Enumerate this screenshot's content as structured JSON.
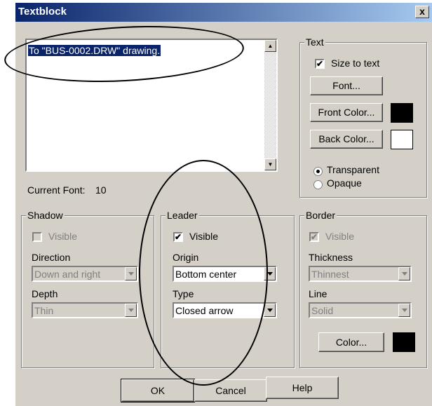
{
  "window": {
    "title": "Textblock",
    "close_label": "x"
  },
  "editor": {
    "text": "To \"BUS-0002.DRW\" drawing."
  },
  "current_font": {
    "label": "Current Font:",
    "value": "10"
  },
  "text_group": {
    "label": "Text",
    "size_to_text": {
      "label": "Size to text",
      "checked": true
    },
    "font_button": "Font...",
    "front_color_button": "Front Color...",
    "front_color": "#000000",
    "back_color_button": "Back Color...",
    "back_color": "#ffffff",
    "transparent_label": "Transparent",
    "opaque_label": "Opaque",
    "selected": "Transparent"
  },
  "shadow_group": {
    "label": "Shadow",
    "visible_label": "Visible",
    "direction_label": "Direction",
    "direction_value": "Down and right",
    "depth_label": "Depth",
    "depth_value": "Thin"
  },
  "leader_group": {
    "label": "Leader",
    "visible_label": "Visible",
    "origin_label": "Origin",
    "origin_value": "Bottom center",
    "type_label": "Type",
    "type_value": "Closed arrow"
  },
  "border_group": {
    "label": "Border",
    "visible_label": "Visible",
    "thickness_label": "Thickness",
    "thickness_value": "Thinnest",
    "line_label": "Line",
    "line_value": "Solid",
    "color_button": "Color...",
    "color": "#000000"
  },
  "buttons": {
    "ok": "OK",
    "cancel": "Cancel",
    "help": "Help"
  }
}
